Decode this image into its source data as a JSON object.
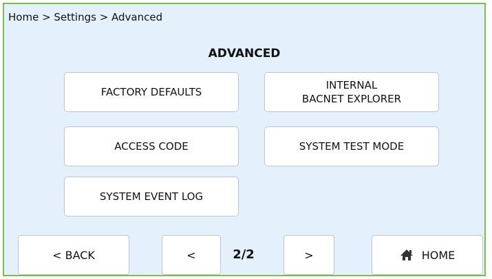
{
  "breadcrumb": "Home > Settings > Advanced",
  "title": "ADVANCED",
  "tiles": {
    "factory_defaults": "FACTORY DEFAULTS",
    "internal_bacnet_explorer": "INTERNAL\nBACNET EXPLORER",
    "access_code": "ACCESS CODE",
    "system_test_mode": "SYSTEM TEST MODE",
    "system_event_log": "SYSTEM EVENT LOG"
  },
  "nav": {
    "back_label": "< BACK",
    "prev_label": "<",
    "page_indicator": "2/2",
    "next_label": ">",
    "home_label": "HOME",
    "home_icon": "home-icon"
  },
  "colors": {
    "background": "#e4f0fb",
    "border": "#7cbc4a",
    "tile": "#ffffff"
  }
}
